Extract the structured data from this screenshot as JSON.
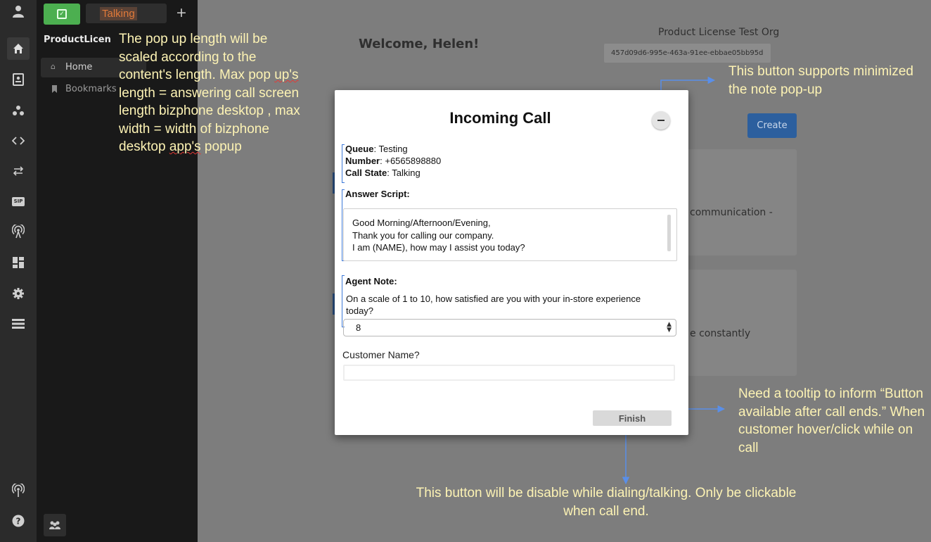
{
  "rail": {
    "icons": [
      "user-icon",
      "home-icon",
      "contacts-icon",
      "groups-icon",
      "code-icon",
      "transfer-icon",
      "sip-icon",
      "broadcast-icon",
      "dashboard-icon",
      "settings-icon",
      "storage-icon",
      "signal-icon",
      "help-icon"
    ],
    "sip_label": "SIP"
  },
  "tabs": {
    "active_label": "Talking",
    "add_label": "+"
  },
  "nav": {
    "title": "ProductLicen",
    "items": [
      {
        "label": "Home",
        "icon": "home-icon"
      },
      {
        "label": "Bookmarks",
        "icon": "bookmark-icon"
      }
    ]
  },
  "main": {
    "welcome": "Welcome, Helen!",
    "org_name": "Product License Test Org",
    "org_id": "457d09d6-995e-463a-91ee-ebbae05bb95d",
    "create_label": "Create",
    "card1_text": "communication -",
    "card2_text": "e constantly"
  },
  "modal": {
    "title": "Incoming Call",
    "queue_label": "Queue",
    "queue_value": ": Testing",
    "number_label": "Number",
    "number_value": ": +6565898880",
    "state_label": "Call State",
    "state_value": ": Talking",
    "answer_script_title": "Answer Script:",
    "script_lines": [
      "Good Morning/Afternoon/Evening,",
      "Thank you for calling our company.",
      "I am (NAME), how may I assist you today?"
    ],
    "agent_note_title": "Agent Note:",
    "agent_note_question": "On a scale of 1 to 10, how satisfied are you with your in-store experience today?",
    "selected_value": "8",
    "customer_name_label": "Customer Name?",
    "customer_name_value": "",
    "finish_label": "Finish"
  },
  "annotations": {
    "popup_length_part1": "The pop up length will be scaled according to the content's length. Max pop ",
    "popup_length_word": "up's",
    "popup_length_part2": "  length = answering call screen length bizphone desktop , max width = width of bizphone desktop ",
    "popup_length_word2": "app's",
    "popup_length_part3": " popup",
    "minimize_note": "This button supports minimized the note pop-up",
    "tooltip_note": "Need a tooltip to inform “Button available after call ends.” When customer hover/click while on call",
    "disable_note": "This button will be disable while dialing/talking. Only be clickable when call end."
  },
  "colors": {
    "accent_blue": "#3c78d8",
    "annotation_text": "#fdf3b4",
    "talking_orange": "#e07a3a",
    "edit_tab_green": "#4caf50"
  }
}
